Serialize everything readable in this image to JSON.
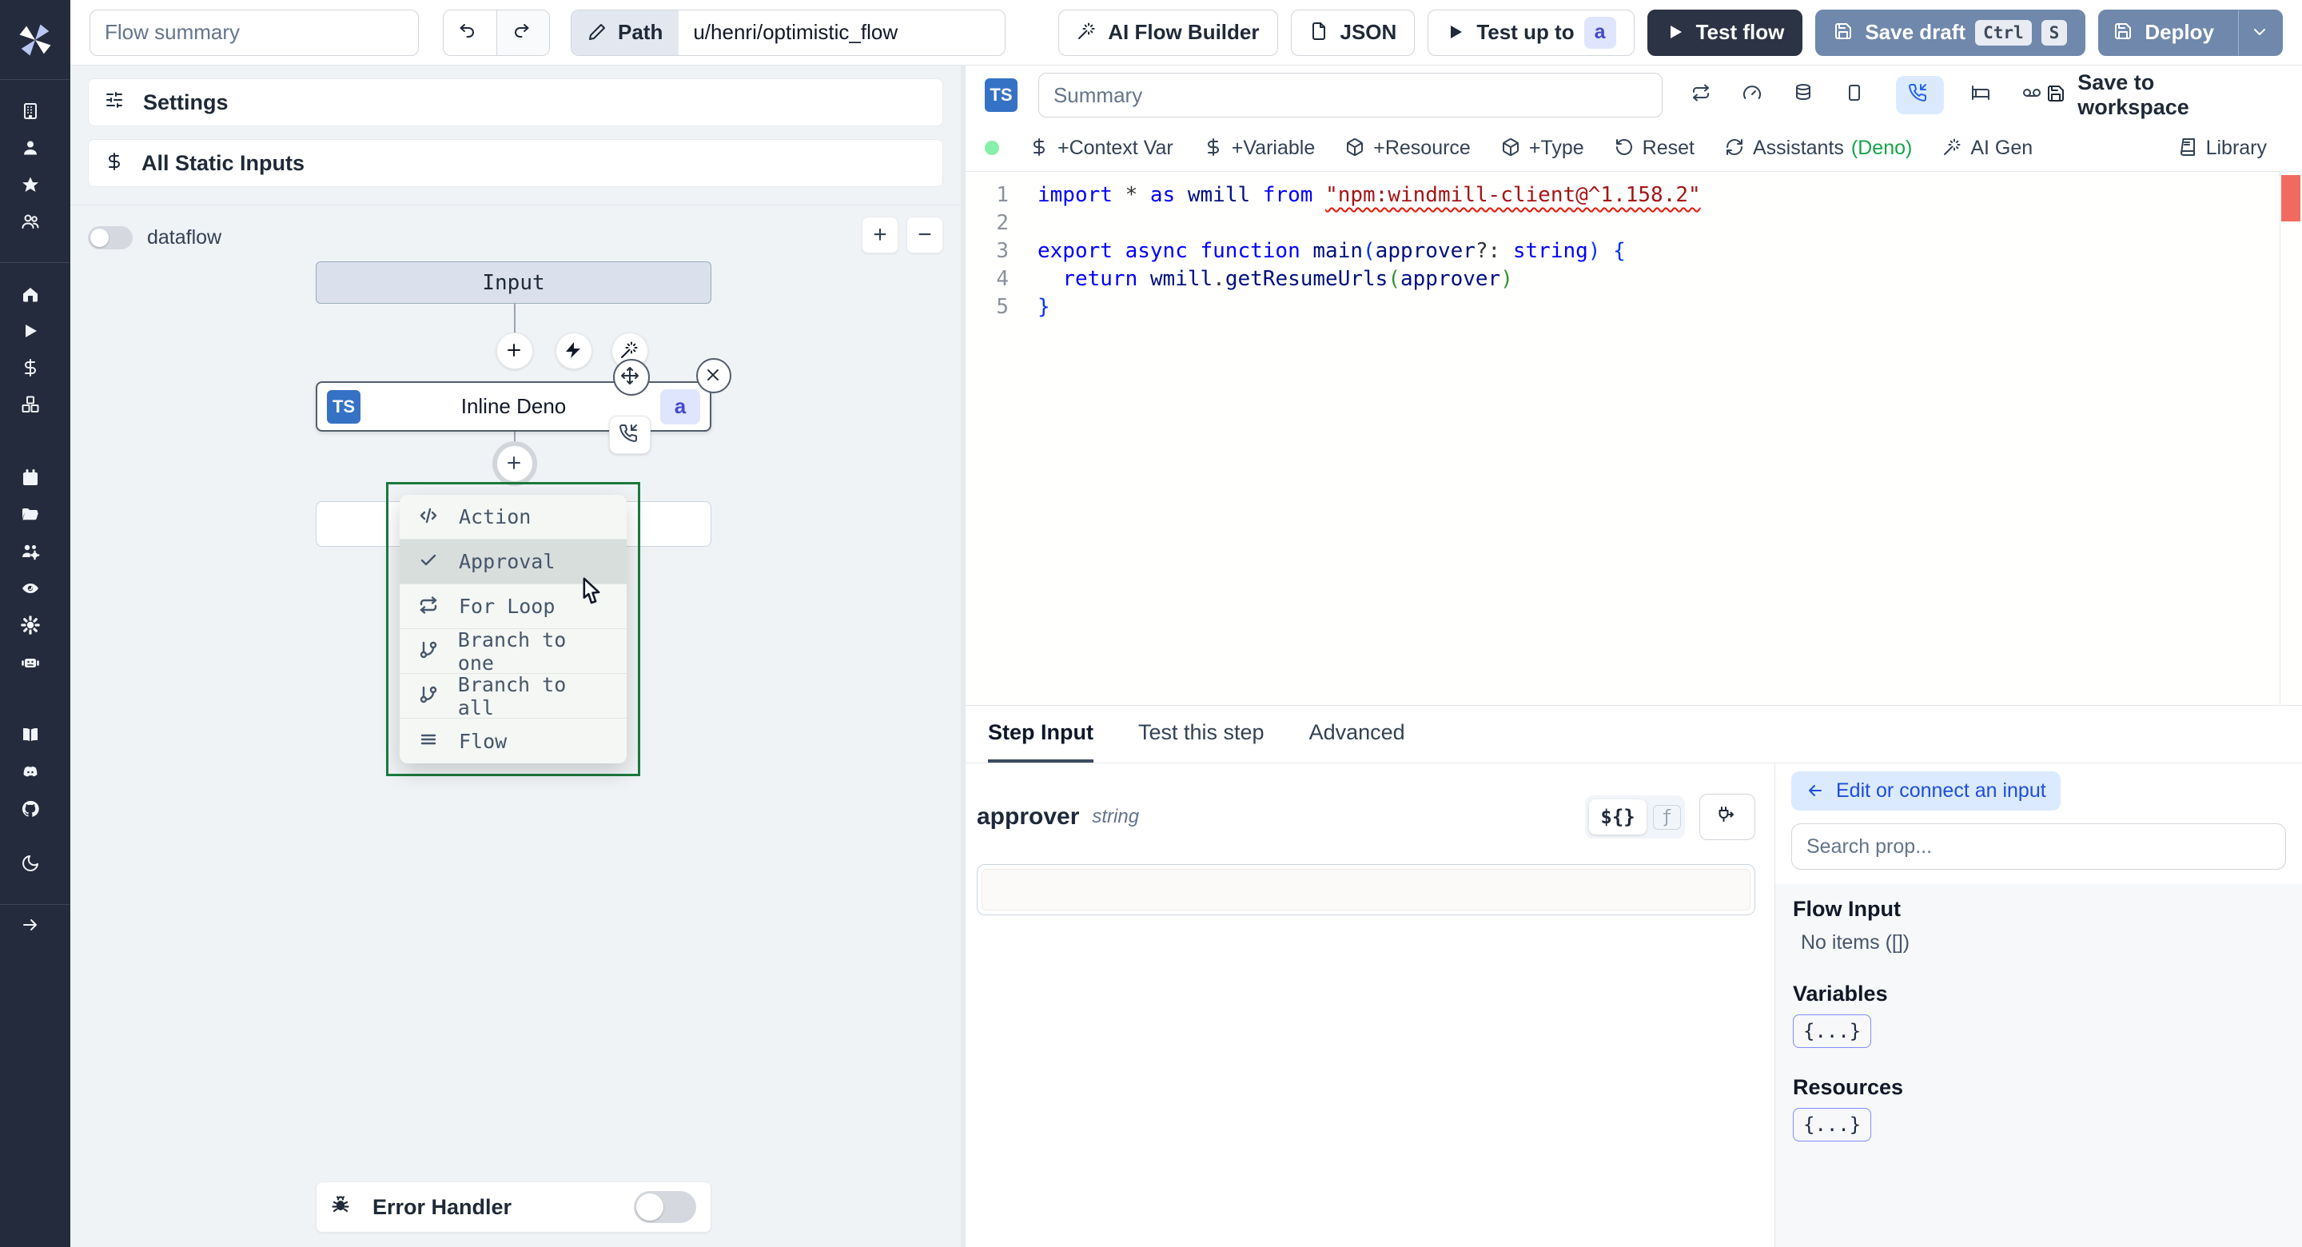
{
  "topbar": {
    "flow_summary_placeholder": "Flow summary",
    "path_label": "Path",
    "path_value": "u/henri/optimistic_flow",
    "ai_flow_builder": "AI Flow Builder",
    "json": "JSON",
    "test_up_to": "Test up to",
    "test_up_to_badge": "a",
    "test_flow": "Test flow",
    "save_draft": "Save draft",
    "kbd_ctrl": "Ctrl",
    "kbd_s": "S",
    "deploy": "Deploy"
  },
  "flow_panel": {
    "settings": "Settings",
    "all_static_inputs": "All Static Inputs",
    "dataflow": "dataflow",
    "zoom_in": "+",
    "zoom_out": "−",
    "input_node": "Input",
    "step_node": {
      "badge": "TS",
      "label": "Inline Deno",
      "suffix_badge": "a"
    },
    "menu": {
      "items": [
        {
          "label": "Action"
        },
        {
          "label": "Approval"
        },
        {
          "label": "For Loop"
        },
        {
          "label": "Branch to one"
        },
        {
          "label": "Branch to all"
        },
        {
          "label": "Flow"
        }
      ]
    },
    "error_handler": "Error Handler"
  },
  "editor": {
    "lang_badge": "TS",
    "summary_placeholder": "Summary",
    "save_to_workspace": "Save to workspace",
    "actions": [
      "+Context Var",
      "+Variable",
      "+Resource",
      "+Type",
      "Reset"
    ],
    "assistants_label": "Assistants",
    "assistants_lang": "(Deno)",
    "ai_gen": "AI Gen",
    "library": "Library",
    "code": {
      "lines": [
        {
          "n": "1",
          "t": [
            [
              "import ",
              "k"
            ],
            [
              "* ",
              "p"
            ],
            [
              "as ",
              "k"
            ],
            [
              "wmill ",
              "id"
            ],
            [
              "from ",
              "k"
            ],
            [
              "\"npm:windmill-client@^1.158.2\"",
              "s"
            ]
          ]
        },
        {
          "n": "2",
          "t": []
        },
        {
          "n": "3",
          "t": [
            [
              "export ",
              "k"
            ],
            [
              "async ",
              "k"
            ],
            [
              "function ",
              "k"
            ],
            [
              "main",
              "id"
            ],
            [
              "(",
              "b1"
            ],
            [
              "approver",
              "id"
            ],
            [
              "?: ",
              "p"
            ],
            [
              "string",
              "k"
            ],
            [
              ")",
              "b1"
            ],
            [
              " ",
              "p"
            ],
            [
              "{",
              "b1"
            ]
          ]
        },
        {
          "n": "4",
          "t": [
            [
              "  ",
              "p"
            ],
            [
              "return ",
              "k"
            ],
            [
              "wmill",
              "id"
            ],
            [
              ".",
              "p"
            ],
            [
              "getResumeUrls",
              "id"
            ],
            [
              "(",
              "b2"
            ],
            [
              "approver",
              "id"
            ],
            [
              ")",
              "b2"
            ]
          ]
        },
        {
          "n": "5",
          "t": [
            [
              "}",
              "b1"
            ]
          ]
        }
      ]
    }
  },
  "step_panel": {
    "tabs": [
      "Step Input",
      "Test this step",
      "Advanced"
    ],
    "field_name": "approver",
    "field_type": "string",
    "toggle_expr": "${}",
    "toggle_fn": "ƒ",
    "connect_pill": "Edit or connect an input",
    "search_placeholder": "Search prop...",
    "flow_input_title": "Flow Input",
    "no_items": "No items ([])",
    "variables_title": "Variables",
    "resources_title": "Resources",
    "object_chip": "{...}"
  }
}
